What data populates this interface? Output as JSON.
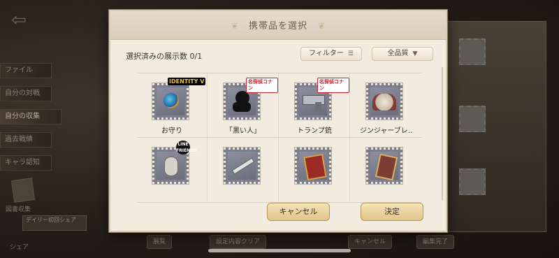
{
  "background": {
    "side_menu": [
      "ファイル",
      "自分の対戦",
      "自分の収集",
      "過去戦績",
      "キャラ認知"
    ],
    "book_label": "図書収集",
    "share_label": "シェア",
    "tooltip": "デイリー初回シェア",
    "bottom_buttons": [
      "展覧",
      "設定内容クリア",
      "キャンセル",
      "編集完了"
    ]
  },
  "dialog": {
    "title": "携帯品を選択",
    "counter": "選択済みの展示数 0/1",
    "filter_label": "フィルター",
    "quality_label": "全品質",
    "items": [
      {
        "name": "お守り",
        "badge": "IDENTITY V",
        "art": "charm"
      },
      {
        "name": "「黒い人」",
        "badge": "名探偵コナン",
        "art": "black-man"
      },
      {
        "name": "トランプ銃",
        "badge": "名探偵コナン",
        "art": "card-gun"
      },
      {
        "name": "ジンジャーブレ..",
        "badge": "",
        "art": "gingerbread"
      },
      {
        "name": "",
        "badge": "LINE FRIENDS",
        "art": "bunny"
      },
      {
        "name": "",
        "badge": "",
        "art": "knife"
      },
      {
        "name": "",
        "badge": "",
        "art": "poster"
      },
      {
        "name": "",
        "badge": "",
        "art": "card"
      }
    ],
    "cancel_label": "キャンセル",
    "confirm_label": "決定"
  },
  "colors": {
    "dialog_bg": "#f2ebe0",
    "button_gold": "#e0c48a",
    "stamp_gray": "#7c7e8c"
  }
}
